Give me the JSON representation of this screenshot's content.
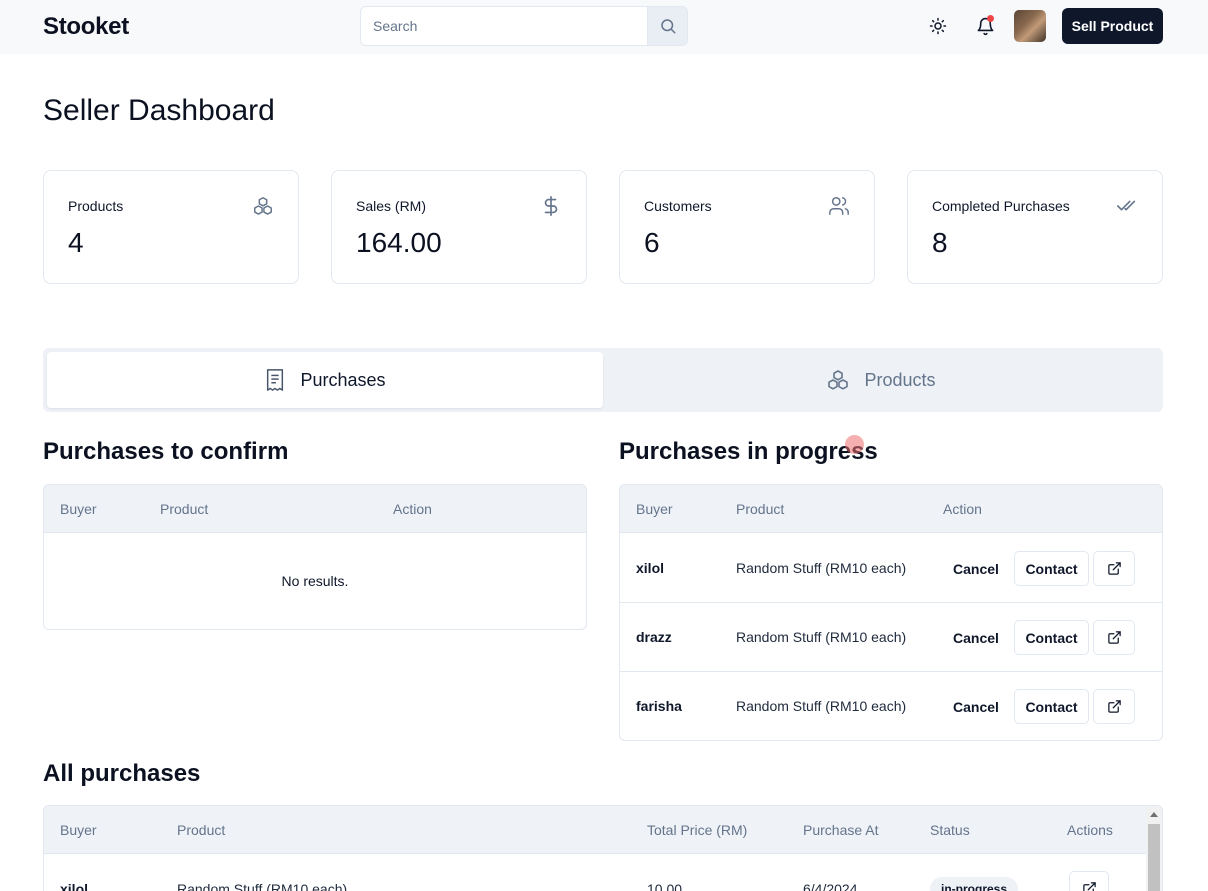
{
  "header": {
    "brand": "Stooket",
    "search_placeholder": "Search",
    "sell_button": "Sell Product"
  },
  "page": {
    "title": "Seller Dashboard"
  },
  "stats": [
    {
      "label": "Products",
      "value": "4",
      "icon": "boxes-icon"
    },
    {
      "label": "Sales (RM)",
      "value": "164.00",
      "icon": "dollar-icon"
    },
    {
      "label": "Customers",
      "value": "6",
      "icon": "users-icon"
    },
    {
      "label": "Completed Purchases",
      "value": "8",
      "icon": "check-check-icon"
    }
  ],
  "tabs": [
    {
      "label": "Purchases",
      "icon": "receipt-icon",
      "active": true
    },
    {
      "label": "Products",
      "icon": "boxes-icon",
      "active": false
    }
  ],
  "confirm": {
    "title": "Purchases to confirm",
    "columns": [
      "Buyer",
      "Product",
      "Action"
    ],
    "empty": "No results."
  },
  "progress": {
    "title": "Purchases in progress",
    "columns": [
      "Buyer",
      "Product",
      "Action"
    ],
    "cancel_label": "Cancel",
    "contact_label": "Contact",
    "rows": [
      {
        "buyer": "xilol",
        "product": "Random Stuff (RM10 each)"
      },
      {
        "buyer": "drazz",
        "product": "Random Stuff (RM10 each)"
      },
      {
        "buyer": "farisha",
        "product": "Random Stuff (RM10 each)"
      }
    ]
  },
  "all": {
    "title": "All purchases",
    "columns": [
      "Buyer",
      "Product",
      "Total Price (RM)",
      "Purchase At",
      "Status",
      "Actions"
    ],
    "rows": [
      {
        "buyer": "xilol",
        "product": "Random Stuff (RM10 each)",
        "total": "10.00",
        "date": "6/4/2024",
        "status": "in-progress"
      }
    ]
  }
}
